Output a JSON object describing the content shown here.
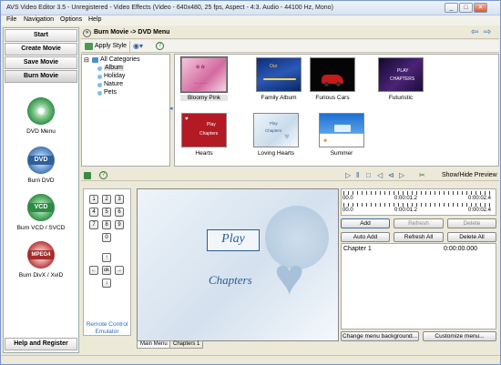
{
  "window": {
    "title": "AVS Video Editor 3.5 - Unregistered - Video Effects (Video - 640x480, 25 fps, Aspect - 4:3. Audio - 44100 Hz, Mono)"
  },
  "menu": [
    "File",
    "Navigation",
    "Options",
    "Help"
  ],
  "left_nav": {
    "buttons": [
      "Start",
      "Create Movie",
      "Save Movie",
      "Burn Movie"
    ],
    "selected": "Burn Movie",
    "items": [
      {
        "label": "DVD Menu",
        "disc": ""
      },
      {
        "label": "Burn DVD",
        "disc": "DVD"
      },
      {
        "label": "Burn VCD / SVCD",
        "disc": "VCD"
      },
      {
        "label": "Burn DivX / XviD",
        "disc": "MPEG4"
      }
    ],
    "help_label": "Help and Register"
  },
  "breadcrumb": "Burn Movie -> DVD Menu",
  "toolbar": {
    "apply_style": "Apply Style"
  },
  "categories": {
    "root": "All Categories",
    "items": [
      "Album",
      "Holiday",
      "Nature",
      "Pets"
    ],
    "selected": "Album"
  },
  "styles": {
    "items": [
      "Bloomy Pink",
      "Family Album",
      "Furious Cars",
      "Futuristic",
      "Hearts",
      "Loving Hearts",
      "Summer"
    ],
    "selected": "Bloomy Pink"
  },
  "thumb_text": {
    "wave1": "Our",
    "wave2": "Hello",
    "futuristic1": "PLAY",
    "futuristic2": "CHAPTERS",
    "hearts1": "Play",
    "hearts2": "Chapters",
    "loving1": "Play",
    "loving2": "Chapters"
  },
  "preview_controls": {
    "show_hide": "Show/Hide Preview"
  },
  "remote": {
    "keys": [
      "1",
      "2",
      "3",
      "4",
      "5",
      "6",
      "7",
      "8",
      "9",
      "0",
      "↑",
      "←",
      "ok",
      "→",
      "↓"
    ],
    "label": "Remote Control Emulator"
  },
  "preview": {
    "play": "Play",
    "chapters": "Chapters"
  },
  "tabs": [
    "Main Menu",
    "Chapters 1"
  ],
  "timeline": {
    "start1": "00.0",
    "mid1": "0:00:01.2",
    "end1": "0:00:02.4",
    "start2": "00.0",
    "mid2": "0:00:01.2",
    "end2": "0:00:02.4"
  },
  "buttons": {
    "add": "Add",
    "refresh": "Refresh",
    "delete": "Delete",
    "auto_add": "Auto Add",
    "refresh_all": "Refresh All",
    "delete_all": "Delete All",
    "change_bg": "Change menu background...",
    "customize": "Customize menu..."
  },
  "chapters": [
    {
      "name": "Chapter 1",
      "time": "0:00:00.000"
    }
  ]
}
